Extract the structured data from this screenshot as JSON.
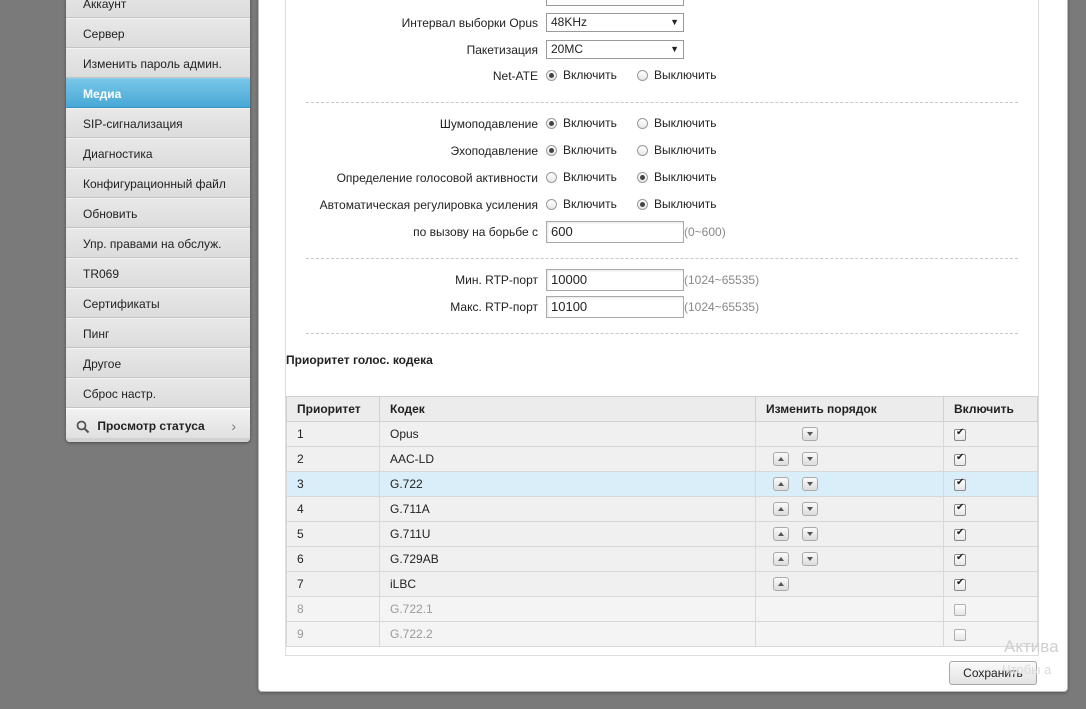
{
  "sidebar": {
    "items": [
      {
        "label": "Аккаунт",
        "active": false
      },
      {
        "label": "Сервер",
        "active": false
      },
      {
        "label": "Изменить пароль админ.",
        "active": false
      },
      {
        "label": "Медиа",
        "active": true
      },
      {
        "label": "SIP-сигнализация",
        "active": false
      },
      {
        "label": "Диагностика",
        "active": false
      },
      {
        "label": "Конфигурационный файл",
        "active": false
      },
      {
        "label": "Обновить",
        "active": false
      },
      {
        "label": "Упр. правами на обслуж.",
        "active": false
      },
      {
        "label": "TR069",
        "active": false
      },
      {
        "label": "Сертификаты",
        "active": false
      },
      {
        "label": "Пинг",
        "active": false
      },
      {
        "label": "Другое",
        "active": false
      },
      {
        "label": "Сброс настр.",
        "active": false
      }
    ],
    "status_view": {
      "label": "Просмотр статуса",
      "icon": "search-icon",
      "chevron": "›"
    }
  },
  "form": {
    "opus_sample_rate": {
      "label": "Интервал выборки Opus",
      "value": "48KHz",
      "arrow": "▼"
    },
    "packetization": {
      "label": "Пакетизация",
      "value": "20MC",
      "arrow": "▼"
    },
    "net_ate": {
      "label": "Net-ATE",
      "on_label": "Включить",
      "off_label": "Выключить",
      "value": "on"
    },
    "noise_suppression": {
      "label": "Шумоподавление",
      "on_label": "Включить",
      "off_label": "Выключить",
      "value": "on"
    },
    "echo_cancellation": {
      "label": "Эхоподавление",
      "on_label": "Включить",
      "off_label": "Выключить",
      "value": "on"
    },
    "vad": {
      "label": "Определение голосовой активности",
      "on_label": "Включить",
      "off_label": "Выключить",
      "value": "off"
    },
    "agc": {
      "label": "Автоматическая регулировка усиления",
      "on_label": "Включить",
      "off_label": "Выключить",
      "value": "off"
    },
    "call_fight": {
      "label": "по вызову на борьбе с",
      "value": "600",
      "hint": "(0~600)"
    },
    "rtp_min": {
      "label": "Мин. RTP-порт",
      "value": "10000",
      "hint": "(1024~65535)"
    },
    "rtp_max": {
      "label": "Макс. RTP-порт",
      "value": "10100",
      "hint": "(1024~65535)"
    }
  },
  "codec_section": {
    "title": "Приоритет голос. кодека",
    "headers": {
      "priority": "Приоритет",
      "codec": "Кодек",
      "order": "Изменить порядок",
      "enable": "Включить"
    },
    "rows": [
      {
        "priority": "1",
        "codec": "Opus",
        "up": false,
        "down": true,
        "enabled": true,
        "disabled": false,
        "highlight": false
      },
      {
        "priority": "2",
        "codec": "AAC-LD",
        "up": true,
        "down": true,
        "enabled": true,
        "disabled": false,
        "highlight": false
      },
      {
        "priority": "3",
        "codec": "G.722",
        "up": true,
        "down": true,
        "enabled": true,
        "disabled": false,
        "highlight": true
      },
      {
        "priority": "4",
        "codec": "G.711A",
        "up": true,
        "down": true,
        "enabled": true,
        "disabled": false,
        "highlight": false
      },
      {
        "priority": "5",
        "codec": "G.711U",
        "up": true,
        "down": true,
        "enabled": true,
        "disabled": false,
        "highlight": false
      },
      {
        "priority": "6",
        "codec": "G.729AB",
        "up": true,
        "down": true,
        "enabled": true,
        "disabled": false,
        "highlight": false
      },
      {
        "priority": "7",
        "codec": "iLBC",
        "up": true,
        "down": false,
        "enabled": true,
        "disabled": false,
        "highlight": false
      },
      {
        "priority": "8",
        "codec": "G.722.1",
        "up": false,
        "down": false,
        "enabled": false,
        "disabled": true,
        "highlight": false
      },
      {
        "priority": "9",
        "codec": "G.722.2",
        "up": false,
        "down": false,
        "enabled": false,
        "disabled": true,
        "highlight": false
      }
    ]
  },
  "actions": {
    "save_label": "Сохранить"
  },
  "overlay": {
    "watermark_line1": "Актива",
    "watermark_line2": "Чтобы а"
  },
  "colors": {
    "accent": "#48a8d6",
    "highlight_row": "#d9eef8",
    "background": "#7a7a7a"
  }
}
